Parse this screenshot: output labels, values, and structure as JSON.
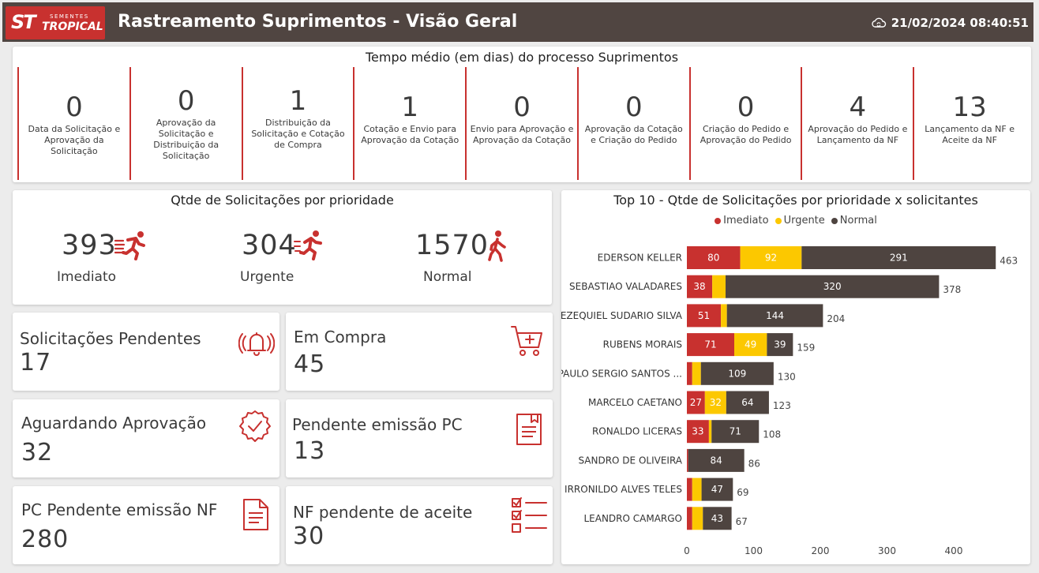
{
  "header": {
    "logo_mark": "ST",
    "logo_top": "SEMENTES",
    "logo_brand": "TROPICAL",
    "title": "Rastreamento Suprimentos - Visão Geral",
    "timestamp": "21/02/2024 08:40:51",
    "timestamp_icon": "cloud-refresh-icon"
  },
  "process": {
    "title": "Tempo médio (em dias) do processo Suprimentos",
    "steps": [
      {
        "value": "0",
        "label": "Data da Solicitação e Aprovação da Solicitação"
      },
      {
        "value": "0",
        "label": "Aprovação da Solicitação e Distribuição da Solicitação"
      },
      {
        "value": "1",
        "label": "Distribuição da Solicitação e Cotação de Compra"
      },
      {
        "value": "1",
        "label": "Cotação e Envio para Aprovação da Cotação"
      },
      {
        "value": "0",
        "label": "Envio para Aprovação e Aprovação da Cotação"
      },
      {
        "value": "0",
        "label": "Aprovação da Cotação e Criação do Pedido"
      },
      {
        "value": "0",
        "label": "Criação do Pedido e Aprovação do Pedido"
      },
      {
        "value": "4",
        "label": "Aprovação do Pedido e Lançamento da NF"
      },
      {
        "value": "13",
        "label": "Lançamento da NF e Aceite da NF"
      }
    ]
  },
  "priority": {
    "title": "Qtde de Solicitações por prioridade",
    "items": [
      {
        "value": "393",
        "label": "Imediato",
        "icon": "sprinter-icon"
      },
      {
        "value": "304",
        "label": "Urgente",
        "icon": "runner-icon"
      },
      {
        "value": "1570",
        "label": "Normal",
        "icon": "walker-icon"
      }
    ]
  },
  "kpis": {
    "pendentes": {
      "label": "Solicitações Pendentes",
      "value": "17",
      "icon": "alarm-bell-icon"
    },
    "em_compra": {
      "label": "Em Compra",
      "value": "45",
      "icon": "shopping-cart-icon"
    },
    "aguardando": {
      "label": "Aguardando Aprovação",
      "value": "32",
      "icon": "approval-badge-icon"
    },
    "pend_pc": {
      "label": "Pendente emissão PC",
      "value": "13",
      "icon": "document-bookmark-icon"
    },
    "pc_nf": {
      "label": "PC Pendente emissão NF",
      "value": "280",
      "icon": "document-icon"
    },
    "nf_aceite": {
      "label": "NF pendente de aceite",
      "value": "30",
      "icon": "checklist-icon"
    }
  },
  "colors": {
    "brand_red": "#c8312f",
    "header_bg": "#504541",
    "imediato": "#c8312f",
    "urgente": "#fcc800",
    "normal": "#4e4440"
  },
  "chart_data": {
    "type": "bar",
    "orientation": "horizontal",
    "stacked": true,
    "title": "Top 10 - Qtde de Solicitações por prioridade x solicitantes",
    "legend_position": "top-center",
    "categories": [
      "EDERSON KELLER",
      "SEBASTIAO VALADARES",
      "EZEQUIEL SUDARIO SILVA",
      "RUBENS MORAIS",
      "PAULO SERGIO SANTOS ...",
      "MARCELO CAETANO",
      "RONALDO LICERAS",
      "SANDRO DE OLIVEIRA",
      "IRRONILDO ALVES TELES",
      "LEANDRO CAMARGO"
    ],
    "series": [
      {
        "name": "Imediato",
        "values": [
          80,
          38,
          51,
          71,
          8,
          27,
          33,
          2,
          8,
          8
        ]
      },
      {
        "name": "Urgente",
        "values": [
          92,
          20,
          9,
          49,
          13,
          32,
          4,
          0,
          14,
          16
        ]
      },
      {
        "name": "Normal",
        "values": [
          291,
          320,
          144,
          39,
          109,
          64,
          71,
          84,
          47,
          43
        ]
      }
    ],
    "totals": [
      463,
      378,
      204,
      159,
      130,
      123,
      108,
      86,
      69,
      67
    ],
    "xticks": [
      0,
      100,
      200,
      300,
      400
    ],
    "xlim": [
      0,
      463
    ],
    "grid": false
  }
}
